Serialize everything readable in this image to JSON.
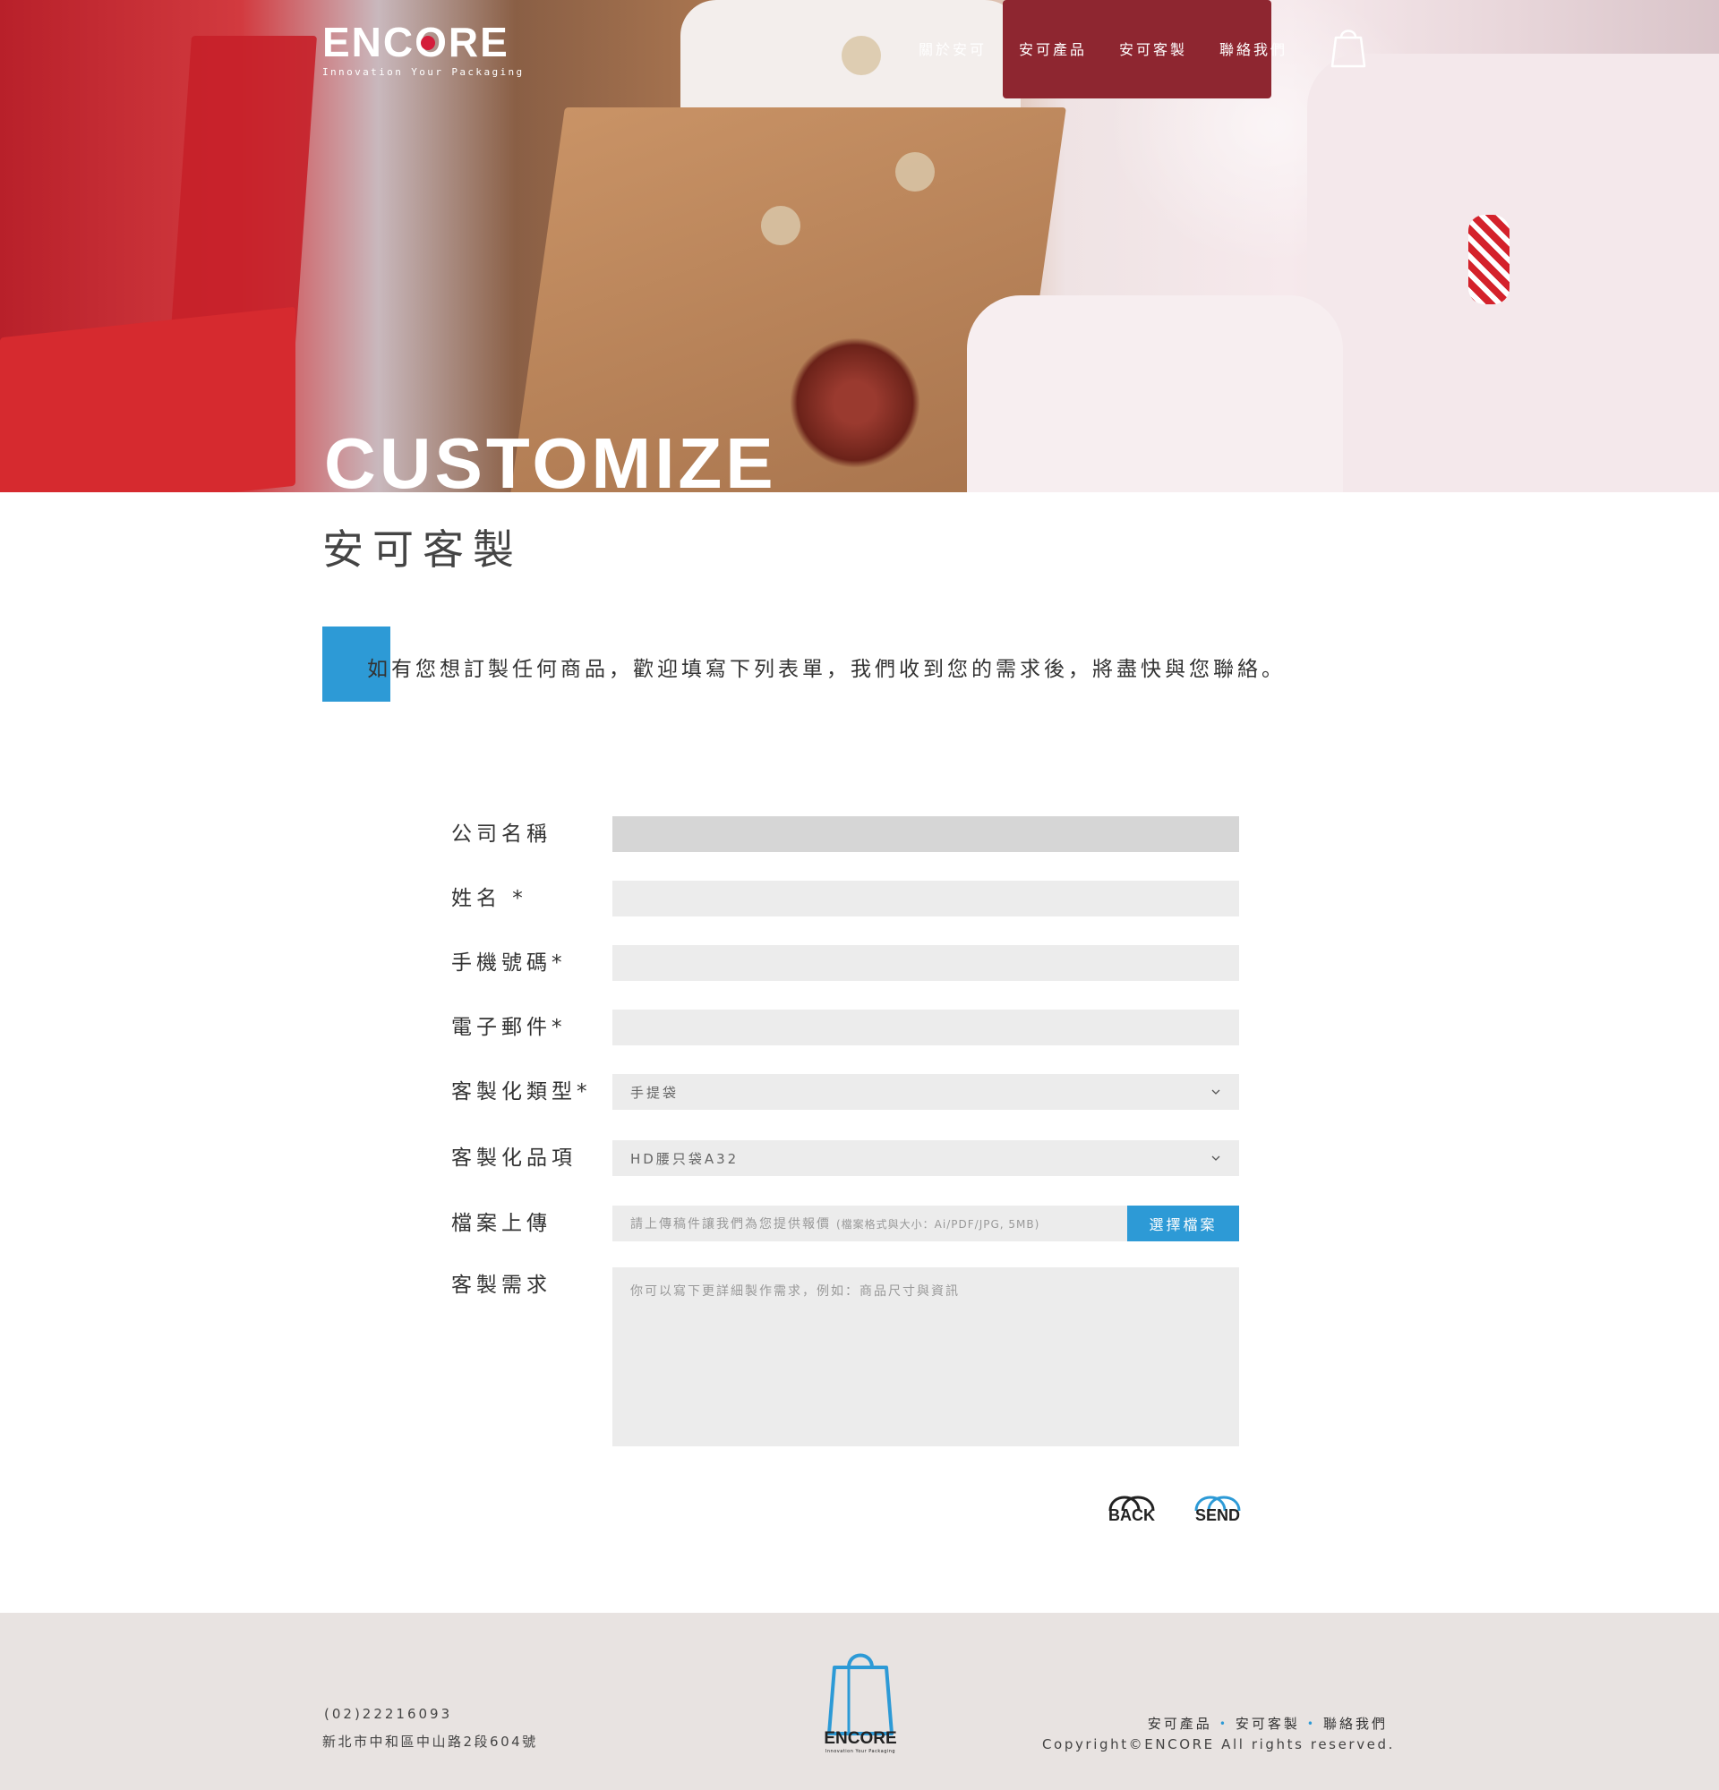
{
  "header": {
    "logo_text": "ENCORE",
    "logo_tagline": "Innovation Your Packaging",
    "nav": [
      "關於安可",
      "安可產品",
      "安可客製",
      "聯絡我們"
    ]
  },
  "hero": {
    "title": "CUSTOMIZE",
    "subtitle": "安可客製"
  },
  "intro": {
    "text": "如有您想訂製任何商品，歡迎填寫下列表單，我們收到您的需求後，將盡快與您聯絡。"
  },
  "form": {
    "company_label": "公司名稱",
    "company_value": "",
    "name_label": "姓名 *",
    "name_value": "",
    "phone_label": "手機號碼*",
    "phone_value": "",
    "email_label": "電子郵件*",
    "email_value": "",
    "type_label": "客製化類型*",
    "type_value": "手提袋",
    "item_label": "客製化品項",
    "item_value": "HD腰只袋A32",
    "file_label": "檔案上傳",
    "file_placeholder": "請上傳稿件讓我們為您提供報價",
    "file_format_note": "(檔案格式與大小：Ai/PDF/JPG, 5MB)",
    "file_button": "選擇檔案",
    "request_label": "客製需求",
    "request_placeholder": "你可以寫下更詳細製作需求，例如：商品尺寸與資訊",
    "back_label": "BACK",
    "send_label": "SEND"
  },
  "footer": {
    "phone": "(02)22216093",
    "address": "新北市中和區中山路2段604號",
    "logo_text": "ENCORE",
    "logo_tagline": "Innovation Your Packaging",
    "links": [
      "安可產品",
      "安可客製",
      "聯絡我們"
    ],
    "link_separator": "•",
    "copyright": "Copyright©ENCORE All rights reserved."
  },
  "colors": {
    "accent": "#2d9ad6",
    "brand_red": "#d41c3a",
    "footer_bg": "#e8e3e1",
    "field_bg": "#ececec"
  },
  "icons": {
    "cart": "shopping-bag-icon",
    "select": "chevron-down-icon"
  }
}
